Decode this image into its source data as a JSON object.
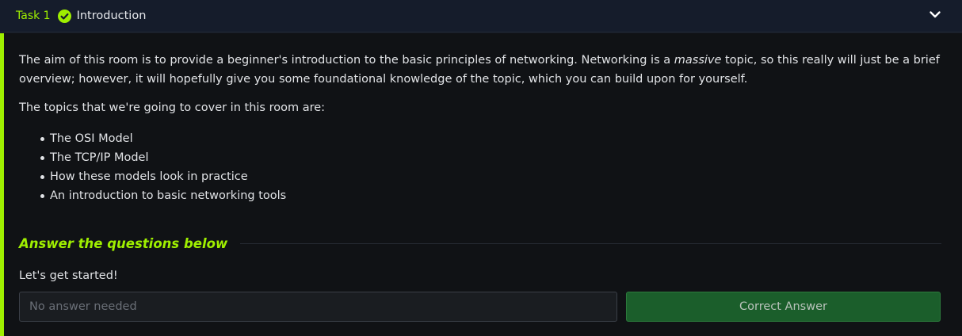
{
  "task": {
    "number": "Task 1",
    "title": "Introduction",
    "accent_color": "#9fef00",
    "completed_icon": "check-circle-icon",
    "toggle_icon": "chevron-down-icon"
  },
  "content": {
    "intro_before": "The aim of this room is to provide a beginner's introduction to the basic principles of networking. Networking is a ",
    "intro_emphasis": "massive",
    "intro_after": " topic, so this really will just be a brief overview; however, it will hopefully give you some foundational knowledge of the topic, which you can build upon for yourself.",
    "topics_intro": "The topics that we're going to cover in this room are:",
    "topics": [
      "The OSI Model",
      "The TCP/IP Model",
      "How these models look in practice",
      "An introduction to basic networking tools"
    ]
  },
  "questions": {
    "heading": "Answer the questions below",
    "items": [
      {
        "question": "Let's get started!",
        "placeholder": "No answer needed",
        "button_label": "Correct Answer",
        "button_color": "#1b5e2b"
      }
    ]
  }
}
